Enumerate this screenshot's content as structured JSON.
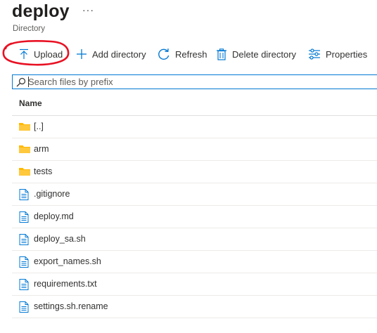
{
  "header": {
    "title": "deploy",
    "more": "···",
    "subtitle": "Directory"
  },
  "toolbar": {
    "upload": "Upload",
    "add_directory": "Add directory",
    "refresh": "Refresh",
    "delete_directory": "Delete directory",
    "properties": "Properties"
  },
  "annotation": {
    "highlight_color": "#e81123",
    "highlighted": "Upload"
  },
  "search": {
    "placeholder": "Search files by prefix",
    "value": ""
  },
  "table": {
    "column_name": "Name",
    "rows": [
      {
        "name": "[..]",
        "type": "folder",
        "icon": "folder-icon"
      },
      {
        "name": "arm",
        "type": "folder",
        "icon": "folder-icon"
      },
      {
        "name": "tests",
        "type": "folder",
        "icon": "folder-icon"
      },
      {
        "name": ".gitignore",
        "type": "file",
        "icon": "file-icon"
      },
      {
        "name": "deploy.md",
        "type": "file",
        "icon": "file-icon"
      },
      {
        "name": "deploy_sa.sh",
        "type": "file",
        "icon": "file-icon"
      },
      {
        "name": "export_names.sh",
        "type": "file",
        "icon": "file-icon"
      },
      {
        "name": "requirements.txt",
        "type": "file",
        "icon": "file-icon"
      },
      {
        "name": "settings.sh.rename",
        "type": "file",
        "icon": "file-icon"
      }
    ]
  },
  "colors": {
    "accent": "#0078d4",
    "folder": "#ffb900",
    "text": "#323130"
  }
}
